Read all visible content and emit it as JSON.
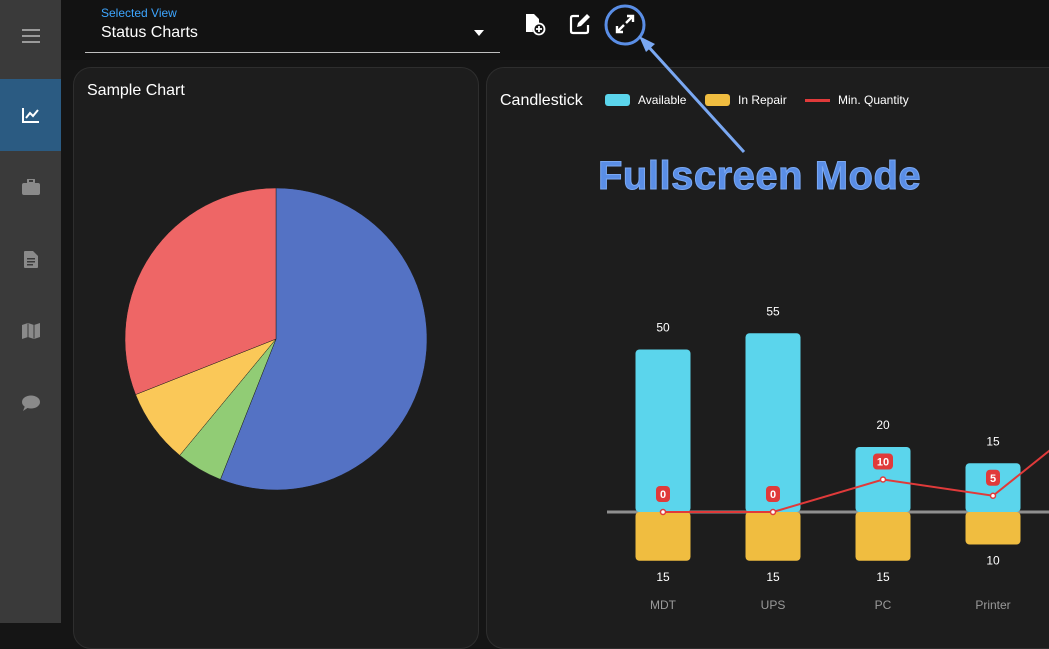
{
  "sidebar": {
    "items": [
      {
        "icon": "menu-icon",
        "active": false
      },
      {
        "icon": "line-chart-icon",
        "active": true
      },
      {
        "icon": "briefcase-icon",
        "active": false
      },
      {
        "icon": "document-icon",
        "active": false
      },
      {
        "icon": "map-icon",
        "active": false
      },
      {
        "icon": "chat-icon",
        "active": false
      }
    ]
  },
  "view_select": {
    "label": "Selected View",
    "value": "Status Charts"
  },
  "toolbar": {
    "buttons": [
      "add-file-icon",
      "edit-icon",
      "fullscreen-icon"
    ]
  },
  "annotation": {
    "text": "Fullscreen Mode"
  },
  "left_card": {
    "title": "Sample Chart"
  },
  "right_card": {
    "title": "Candlestick",
    "legend": [
      {
        "label": "Available",
        "color": "#5bd5ec",
        "kind": "box"
      },
      {
        "label": "In Repair",
        "color": "#f0bd40",
        "kind": "box"
      },
      {
        "label": "Min. Quantity",
        "color": "#e03a3a",
        "kind": "line"
      }
    ]
  },
  "chart_data": [
    {
      "type": "pie",
      "title": "Sample Chart",
      "slices": [
        {
          "value": 56,
          "color": "#5472c4"
        },
        {
          "value": 5,
          "color": "#91cc75"
        },
        {
          "value": 8,
          "color": "#fac858"
        },
        {
          "value": 31,
          "color": "#ee6666"
        }
      ]
    },
    {
      "type": "bar",
      "title": "Candlestick",
      "categories": [
        "MDT",
        "UPS",
        "PC",
        "Printer"
      ],
      "series": [
        {
          "name": "Available",
          "color": "#5bd5ec",
          "values": [
            50,
            55,
            20,
            15
          ]
        },
        {
          "name": "In Repair",
          "color": "#f0bd40",
          "values": [
            15,
            15,
            15,
            10
          ]
        },
        {
          "name": "Min. Quantity",
          "color": "#e03a3a",
          "values": [
            0,
            0,
            10,
            5
          ]
        }
      ]
    }
  ]
}
